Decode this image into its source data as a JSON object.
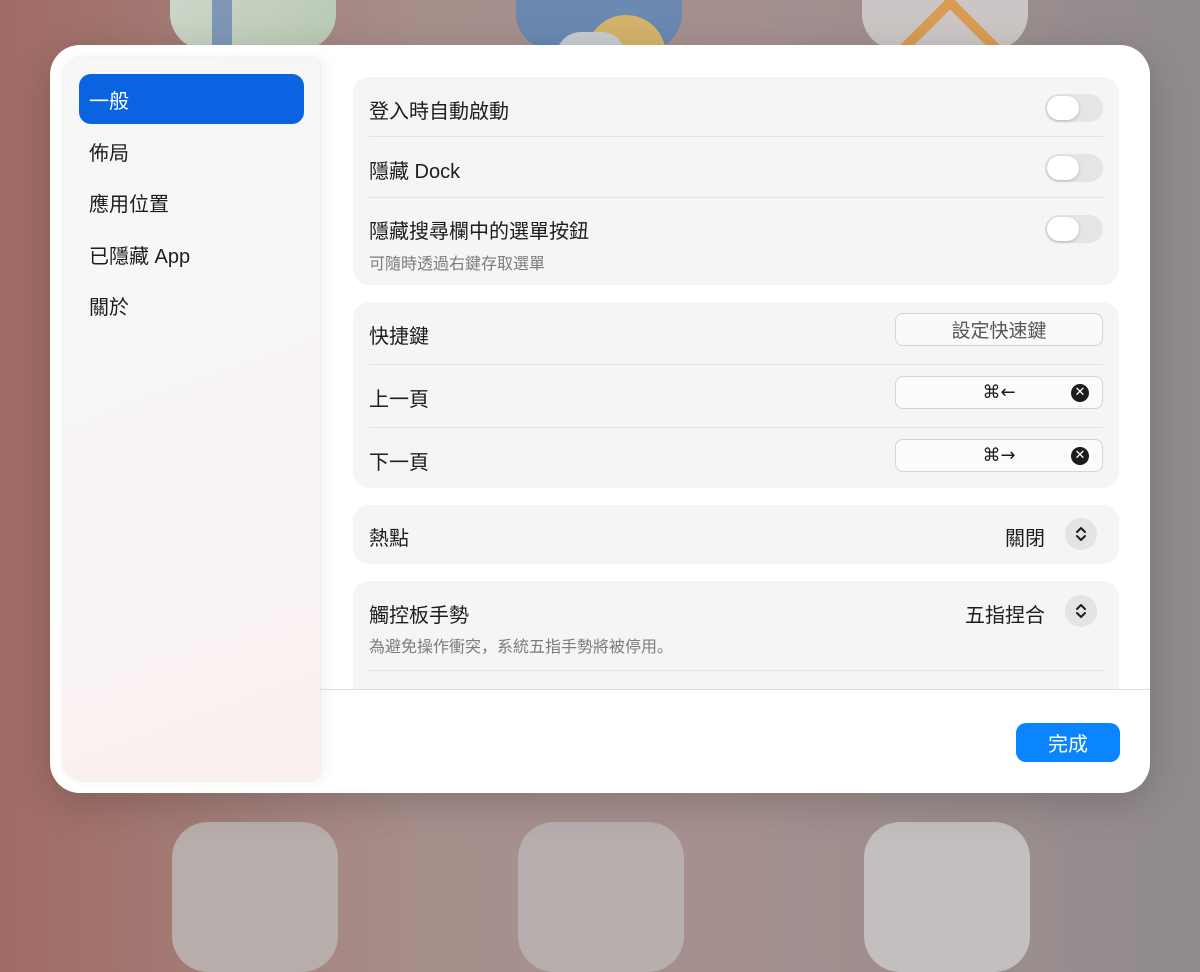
{
  "sidebar": {
    "items": [
      {
        "label": "一般",
        "active": true
      },
      {
        "label": "佈局",
        "active": false
      },
      {
        "label": "應用位置",
        "active": false
      },
      {
        "label": "已隱藏 App",
        "active": false
      },
      {
        "label": "關於",
        "active": false
      }
    ]
  },
  "general": {
    "auto_launch": {
      "label": "登入時自動啟動",
      "enabled": false
    },
    "hide_dock": {
      "label": "隱藏 Dock",
      "enabled": false
    },
    "hide_menu_button": {
      "label": "隱藏搜尋欄中的選單按鈕",
      "hint": "可隨時透過右鍵存取選單",
      "enabled": false
    }
  },
  "shortcuts": {
    "label": "快捷鍵",
    "set_button": "設定快速鍵",
    "prev_page": {
      "label": "上一頁",
      "keys": "⌘←"
    },
    "next_page": {
      "label": "下一頁",
      "keys": "⌘→"
    }
  },
  "hot_corners": {
    "label": "熱點",
    "value": "關閉"
  },
  "trackpad": {
    "label": "觸控板手勢",
    "value": "五指捏合",
    "hint": "為避免操作衝突，系統五指手勢將被停用。"
  },
  "footer": {
    "done_label": "完成"
  },
  "colors": {
    "accent": "#0a63e0",
    "done_button": "#0a84ff"
  },
  "icons": {
    "clear": "xmark-circle-icon",
    "stepper": "chevron-up-down-icon"
  }
}
